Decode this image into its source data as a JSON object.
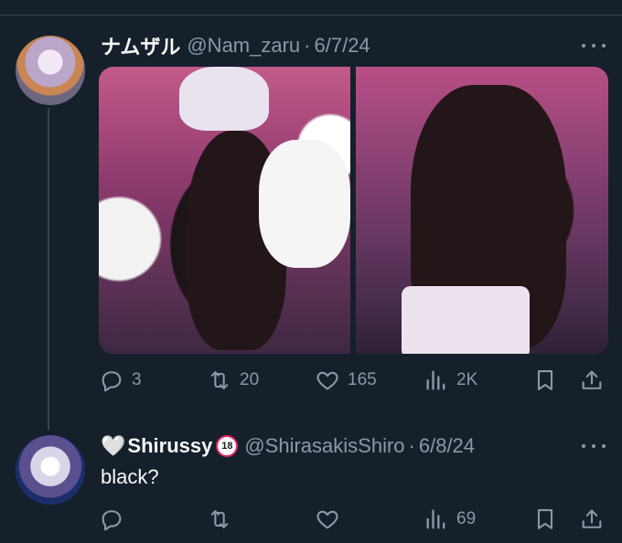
{
  "post1": {
    "display_name": "ナムザル",
    "handle": "@Nam_zaru",
    "date": "6/7/24",
    "stats": {
      "replies": "3",
      "retweets": "20",
      "likes": "165",
      "views": "2K"
    }
  },
  "post2": {
    "display_name_emoji": "🤍",
    "display_name": "Shirussy",
    "badge": "18",
    "handle": "@ShirasakisShiro",
    "date": "6/8/24",
    "text": "black?",
    "stats": {
      "replies": "",
      "retweets": "",
      "likes": "",
      "views": "69"
    }
  },
  "separator": "·",
  "icons": {
    "reply": "reply-icon",
    "retweet": "retweet-icon",
    "like": "heart-icon",
    "views": "views-icon",
    "bookmark": "bookmark-icon",
    "share": "share-icon",
    "more": "more-icon"
  },
  "colors": {
    "background": "#15202b",
    "text": "#f7f9f9",
    "muted": "#8b98a5",
    "divider": "#38444d"
  }
}
